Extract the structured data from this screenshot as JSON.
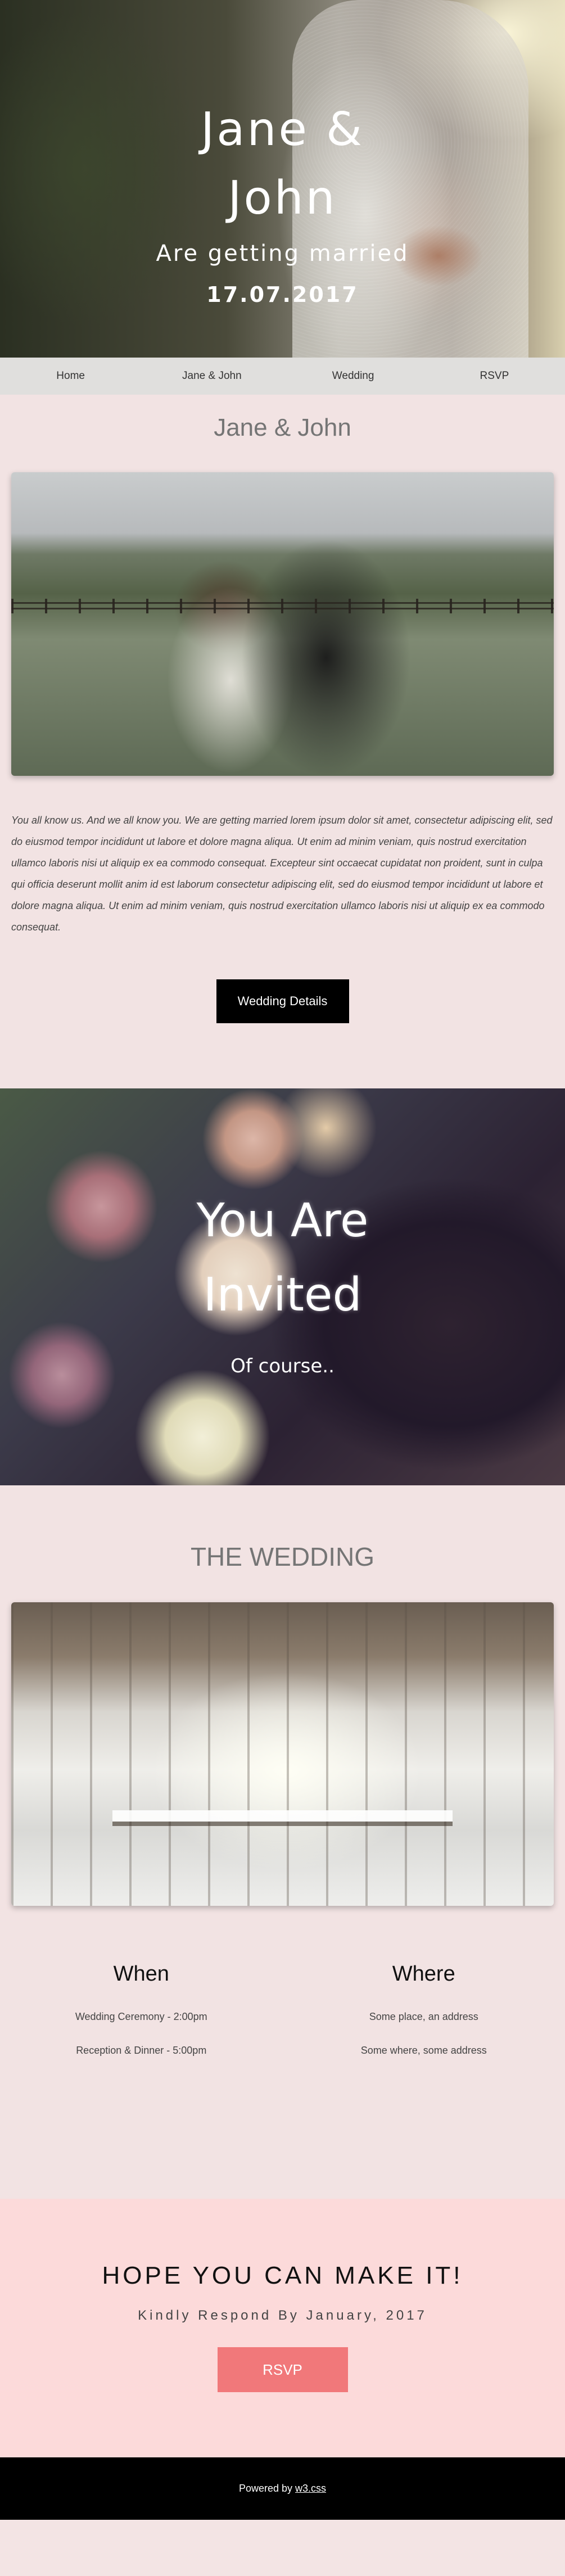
{
  "hero": {
    "title": "Jane & John",
    "subtitle": "Are getting married",
    "date": "17.07.2017"
  },
  "nav": {
    "items": [
      {
        "label": "Home"
      },
      {
        "label": "Jane & John"
      },
      {
        "label": "Wedding"
      },
      {
        "label": "RSVP"
      }
    ]
  },
  "couple_section": {
    "title": "Jane & John",
    "body": "You all know us. And we all know you. We are getting married lorem ipsum dolor sit amet, consectetur adipiscing elit, sed do eiusmod tempor incididunt ut labore et dolore magna aliqua. Ut enim ad minim veniam, quis nostrud exercitation ullamco laboris nisi ut aliquip ex ea commodo consequat. Excepteur sint occaecat cupidatat non proident, sunt in culpa qui officia deserunt mollit anim id est laborum consectetur adipiscing elit, sed do eiusmod tempor incididunt ut labore et dolore magna aliqua. Ut enim ad minim veniam, quis nostrud exercitation ullamco laboris nisi ut aliquip ex ea commodo consequat.",
    "button": "Wedding Details"
  },
  "invited": {
    "title": "You Are Invited",
    "subtitle": "Of course.."
  },
  "wedding_section": {
    "title": "THE WEDDING",
    "when": {
      "heading": "When",
      "lines": [
        "Wedding Ceremony - 2:00pm",
        "Reception & Dinner - 5:00pm"
      ]
    },
    "where": {
      "heading": "Where",
      "lines": [
        "Some place, an address",
        "Some where, some address"
      ]
    }
  },
  "rsvp": {
    "heading": "HOPE YOU CAN MAKE IT!",
    "respond": "Kindly Respond By January, 2017",
    "button": "RSVP"
  },
  "footer": {
    "prefix": "Powered by ",
    "link": "w3.css"
  }
}
